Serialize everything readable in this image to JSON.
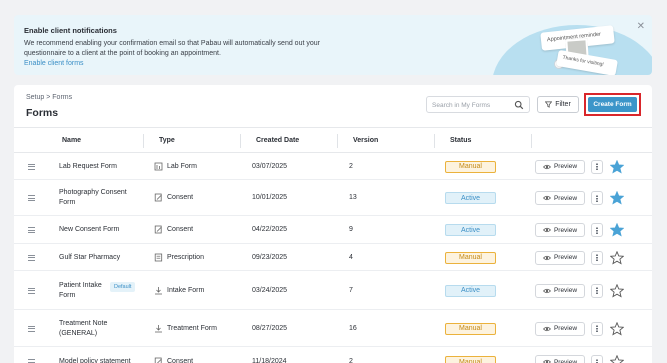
{
  "banner": {
    "title": "Enable client notifications",
    "body": "We recommend enabling your confirmation email so that Pabau will automatically send out your questionnaire to a client at the point of booking an appointment.",
    "link": "Enable client forms",
    "close_icon": "close-icon",
    "card_reminder": "Appointment reminder",
    "card_thanks": "Thanks for visiting!"
  },
  "breadcrumb": "Setup > Forms",
  "page_title": "Forms",
  "search": {
    "placeholder": "Search in My Forms",
    "icon": "search-icon"
  },
  "toolbar": {
    "filter_label": "Filter",
    "create_label": "Create Form",
    "highlight_color": "#d9262b"
  },
  "columns": [
    "Name",
    "Type",
    "Created Date",
    "Version",
    "Status"
  ],
  "colors": {
    "accent": "#3c95c9",
    "manual": "#ebb23c",
    "active": "#3b8fc6",
    "star_filled": "#4aa3d6"
  },
  "rows": [
    {
      "name": "Lab Request Form",
      "type": "Lab Form",
      "type_icon": "lab-icon",
      "date": "03/07/2025",
      "version": "2",
      "status": "Manual",
      "preview": "Preview",
      "favorite": true
    },
    {
      "name": "Photography Consent Form",
      "type": "Consent",
      "type_icon": "consent-icon",
      "date": "10/01/2025",
      "version": "13",
      "status": "Active",
      "preview": "Preview",
      "favorite": true
    },
    {
      "name": "New Consent Form",
      "type": "Consent",
      "type_icon": "consent-icon",
      "date": "04/22/2025",
      "version": "9",
      "status": "Active",
      "preview": "Preview",
      "favorite": true
    },
    {
      "name": "Gulf Star Pharmacy",
      "type": "Prescription",
      "type_icon": "prescription-icon",
      "date": "09/23/2025",
      "version": "4",
      "status": "Manual",
      "preview": "Preview",
      "favorite": false
    },
    {
      "name": "Patient Intake Form",
      "badge": "Default",
      "type": "Intake Form",
      "type_icon": "intake-icon",
      "date": "03/24/2025",
      "version": "7",
      "status": "Active",
      "preview": "Preview",
      "favorite": false
    },
    {
      "name": "Treatment Note (GENERAL)",
      "type": "Treatment Form",
      "type_icon": "treatment-icon",
      "date": "08/27/2025",
      "version": "16",
      "status": "Manual",
      "preview": "Preview",
      "favorite": false
    },
    {
      "name": "Model policy statement",
      "type": "Consent",
      "type_icon": "consent-icon",
      "date": "11/18/2024",
      "version": "2",
      "status": "Manual",
      "preview": "Preview",
      "favorite": false
    }
  ]
}
